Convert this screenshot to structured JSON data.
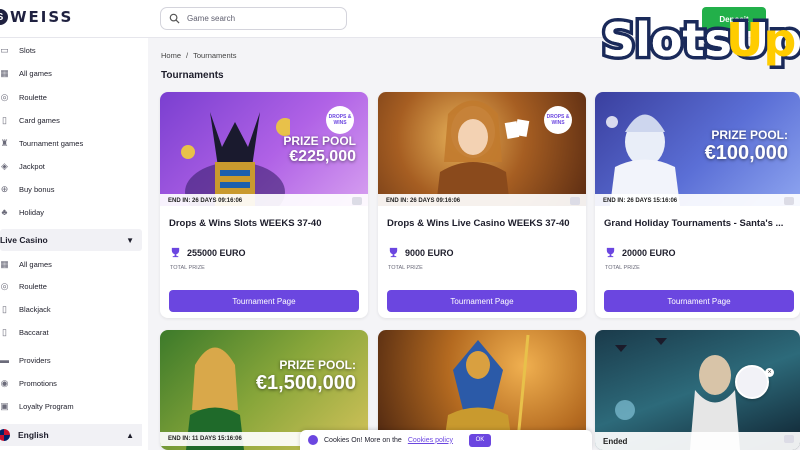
{
  "header": {
    "brand": "WEISS",
    "brand_mark": "S",
    "search_placeholder": "Game search",
    "deposit_label": "Deposit"
  },
  "sidebar": {
    "items": [
      {
        "label": "Slots",
        "icon": "slots-icon"
      },
      {
        "label": "All games",
        "icon": "grid-icon"
      },
      {
        "label": "Roulette",
        "icon": "roulette-icon"
      },
      {
        "label": "Card games",
        "icon": "cards-icon"
      },
      {
        "label": "Tournament games",
        "icon": "tournament-icon"
      },
      {
        "label": "Jackpot",
        "icon": "jackpot-icon"
      },
      {
        "label": "Buy bonus",
        "icon": "plus-icon"
      },
      {
        "label": "Holiday",
        "icon": "tree-icon"
      }
    ],
    "live_casino": {
      "label": "Live Casino",
      "items": [
        {
          "label": "All games",
          "icon": "grid-icon"
        },
        {
          "label": "Roulette",
          "icon": "roulette-icon"
        },
        {
          "label": "Blackjack",
          "icon": "blackjack-icon"
        },
        {
          "label": "Baccarat",
          "icon": "baccarat-icon"
        }
      ]
    },
    "bottom_items": [
      {
        "label": "Providers",
        "icon": "providers-icon"
      },
      {
        "label": "Promotions",
        "icon": "promotions-icon"
      },
      {
        "label": "Loyalty Program",
        "icon": "loyalty-icon"
      }
    ],
    "language": "English"
  },
  "breadcrumb": {
    "home": "Home",
    "sep": "/",
    "current": "Tournaments"
  },
  "page_title": "Tournaments",
  "cards": [
    {
      "ends": "END IN: 26 DAYS 09:16:06",
      "badge": "DROPS & WINS",
      "prize_line1": "PRIZE POOL",
      "prize_line2": "€225,000",
      "title": "Drops & Wins Slots WEEKS 37-40",
      "amount": "255000 EURO",
      "amount_label": "TOTAL PRIZE",
      "button": "Tournament Page"
    },
    {
      "ends": "END IN: 26 DAYS 09:16:06",
      "badge": "DROPS & WINS",
      "title": "Drops & Wins Live Casino WEEKS 37-40",
      "amount": "9000 EURO",
      "amount_label": "TOTAL PRIZE",
      "button": "Tournament Page"
    },
    {
      "ends": "END IN: 26 DAYS 15:16:06",
      "prize_line1": "PRIZE POOL:",
      "prize_line2": "€100,000",
      "title": "Grand Holiday Tournaments - Santa's ...",
      "amount": "20000 EURO",
      "amount_label": "TOTAL PRIZE",
      "button": "Tournament Page"
    },
    {
      "ends": "END IN: 11 DAYS 15:16:06",
      "prize_line1": "PRIZE POOL:",
      "prize_line2": "€1,500,000"
    },
    {
      "ends": ""
    },
    {
      "ends": "Ended"
    }
  ],
  "cookie": {
    "text": "Cookies On! More on the",
    "link": "Cookies policy",
    "ok": "OK"
  },
  "watermark": "SlotsUp",
  "colors": {
    "accent": "#6b46e0",
    "deposit": "#22b04a"
  }
}
